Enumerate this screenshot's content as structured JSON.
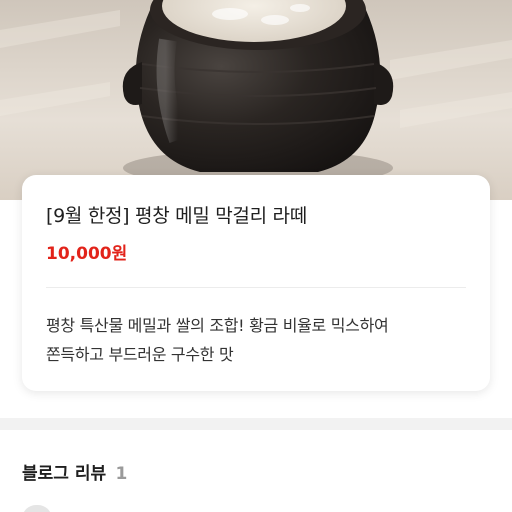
{
  "product": {
    "title": "[9월 한정] 평창 메밀 막걸리 라떼",
    "price": "10,000원",
    "description_line1": "평창 특산물 메밀과 쌀의 조합! 황금 비율로 믹스하여",
    "description_line2": "쫀득하고 부드러운 구수한 맛"
  },
  "reviews": {
    "title": "블로그 리뷰",
    "count": "1"
  },
  "colors": {
    "price": "#e2231a",
    "count": "#9a9a9a"
  }
}
